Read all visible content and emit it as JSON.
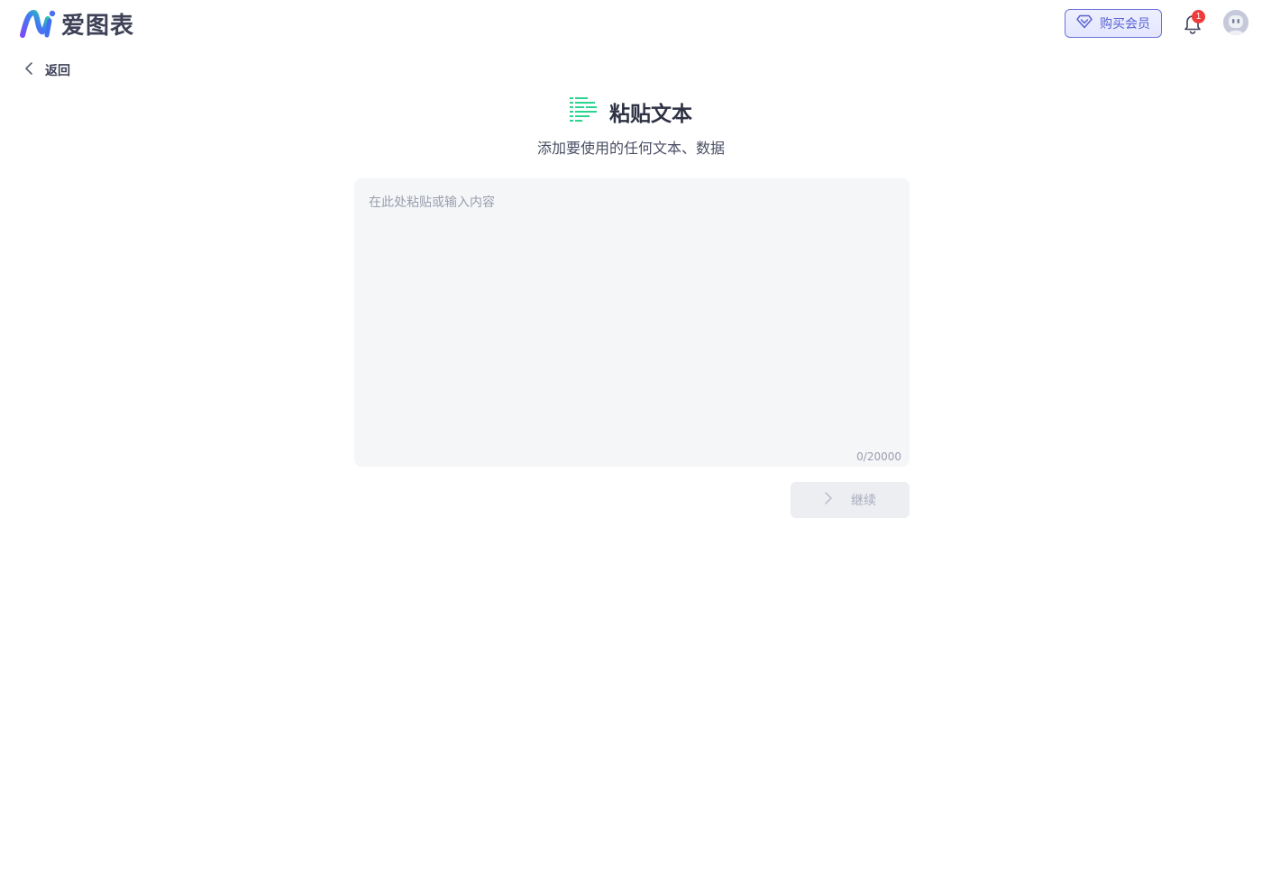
{
  "header": {
    "logo_text": "爱图表",
    "vip_button_label": "购买会员",
    "notification_count": "1"
  },
  "nav": {
    "back_label": "返回"
  },
  "main": {
    "title": "粘贴文本",
    "subtitle": "添加要使用的任何文本、数据",
    "input": {
      "placeholder": "在此处粘贴或输入内容",
      "value": "",
      "counter": "0/20000"
    },
    "continue_label": "继续"
  },
  "colors": {
    "brand_purple": "#5a62d0",
    "title_icon_green": "#2bd48f",
    "badge_red": "#ef3b3b"
  },
  "icons": {
    "logo": "ai-logo-icon",
    "vip": "diamond-icon",
    "bell": "bell-icon",
    "avatar": "robot-avatar-icon",
    "back": "chevron-left-icon",
    "title": "paste-text-icon",
    "continue": "chevron-right-icon"
  }
}
